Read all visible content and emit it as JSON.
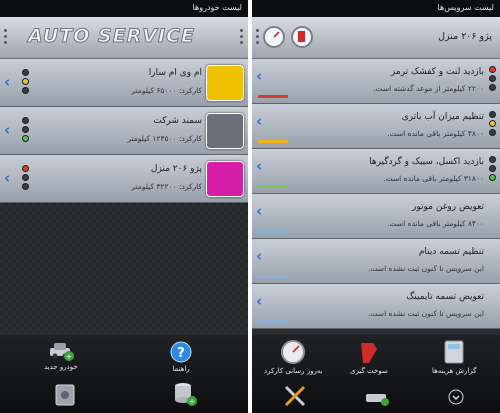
{
  "left": {
    "status_title": "لیست خودروها",
    "logo_text": "AUTO SERVICE",
    "cars": [
      {
        "name": "ام وی ام سارا",
        "usage": "کارکرد: ۶۵۰۰۰ کیلومتر",
        "light": "yellow",
        "color": "#f0c100"
      },
      {
        "name": "سمند شرکت",
        "usage": "کارکرد: ۱۲۳۵۰۰ کیلومتر",
        "light": "green",
        "color": "#6b6f76"
      },
      {
        "name": "پژو ۲۰۶ منزل",
        "usage": "کارکرد: ۳۲۲۰۰ کیلومتر",
        "light": "red",
        "color": "#d51fa6"
      }
    ],
    "buttons": {
      "new_car": "خودرو جدید",
      "help": "راهنما"
    }
  },
  "right": {
    "status_title": "لیست سرویس‌ها",
    "car_title": "پژو ۲۰۶ منزل",
    "services": [
      {
        "title": "بازدید لنت و کفشک ترمز",
        "detail": "۲۲۰۰ کیلومتر از موعد گذشته است.",
        "light": "red",
        "bar": "#d83b2c"
      },
      {
        "title": "تنظیم میزان آب باتری",
        "detail": "۴۸۰۰ کیلومتر باقی مانده است.",
        "light": "yellow",
        "bar": "#f0b21a"
      },
      {
        "title": "بازدید اکسل، سیبک و گردگیرها",
        "detail": "۳۱۸۰۰ کیلومتر باقی مانده است.",
        "light": "green",
        "bar": "#7fc25e"
      },
      {
        "title": "تعویض روغن موتور",
        "detail": "۸۴۰۰ کیلومتر باقی مانده است.",
        "light": "none",
        "bar": "#8fb0d6"
      },
      {
        "title": "تنظیم تسمه دینام",
        "detail": "این سرویس تا کنون ثبت نشده است.",
        "light": "none",
        "bar": "#8fb0d6"
      },
      {
        "title": "تعویض تسمه تایمینگ",
        "detail": "این سرویس تا کنون ثبت نشده است.",
        "light": "none",
        "bar": "#8fb0d6"
      }
    ],
    "buttons": {
      "report": "گزارش هزینه‌ها",
      "fuel": "سوخت گیری",
      "odometer": "بەروز رسانی کارکرد"
    }
  }
}
